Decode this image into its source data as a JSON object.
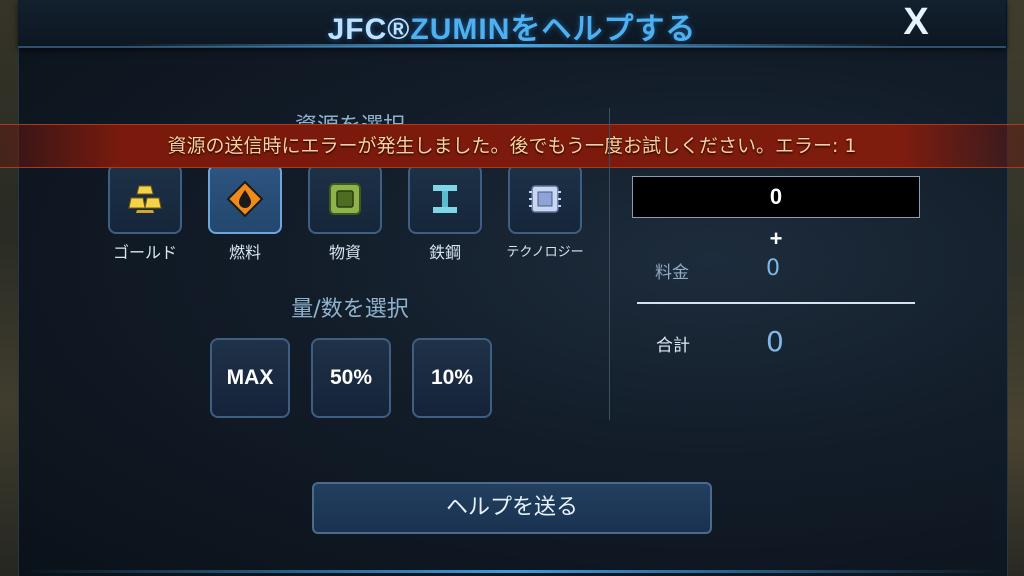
{
  "header": {
    "title_prefix": "JFC®",
    "title_main": "ZUMINをヘルプする",
    "close_label": "X"
  },
  "resources": {
    "section_label": "資源を選択",
    "items": [
      {
        "label": "ゴールド",
        "icon": "gold-bars-icon"
      },
      {
        "label": "燃料",
        "icon": "fuel-drop-icon",
        "selected": true
      },
      {
        "label": "物資",
        "icon": "supply-crate-icon"
      },
      {
        "label": "鉄鋼",
        "icon": "steel-beam-icon"
      },
      {
        "label": "テクノロジー",
        "icon": "tech-chip-icon"
      }
    ]
  },
  "error": {
    "message": "資源の送信時にエラーが発生しました。後でもう一度お試しください。エラー: 1"
  },
  "amount": {
    "section_label": "量/数を選択",
    "options": [
      "MAX",
      "50%",
      "10%"
    ]
  },
  "summary": {
    "input_value": "0",
    "plus": "+",
    "fee_label": "料金",
    "fee_value": "0",
    "total_label": "合計",
    "total_value": "0"
  },
  "footer": {
    "send_label": "ヘルプを送る"
  },
  "colors": {
    "accent_blue": "#4fb0f0",
    "error_red": "#7e1c0e",
    "error_text": "#ffcf9a"
  }
}
